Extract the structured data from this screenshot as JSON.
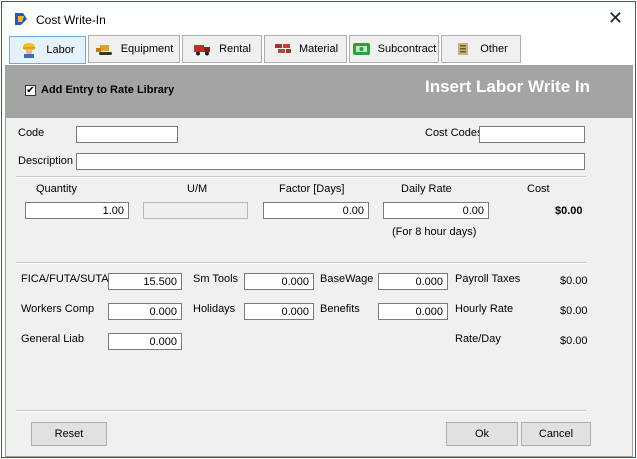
{
  "window": {
    "title": "Cost Write-In",
    "close_glyph": "✕"
  },
  "tabs": [
    {
      "label": "Labor",
      "icon": "worker-icon"
    },
    {
      "label": "Equipment",
      "icon": "bulldozer-icon"
    },
    {
      "label": "Rental",
      "icon": "rental-truck-icon"
    },
    {
      "label": "Material",
      "icon": "bricks-icon"
    },
    {
      "label": "Subcontract",
      "icon": "subcontract-icon"
    },
    {
      "label": "Other",
      "icon": "other-icon"
    }
  ],
  "banner": {
    "checkbox_label": "Add Entry to Rate Library",
    "checkbox_checked": "✔",
    "title": "Insert Labor Write In"
  },
  "form": {
    "code_label": "Code",
    "code_value": "",
    "cost_codes_label": "Cost Codes",
    "cost_codes_value": "",
    "description_label": "Description",
    "description_value": "",
    "quantity_label": "Quantity",
    "quantity_value": "1.00",
    "um_label": "U/M",
    "um_value": "",
    "factor_label": "Factor [Days]",
    "factor_value": "0.00",
    "daily_rate_label": "Daily Rate",
    "daily_rate_value": "0.00",
    "daily_rate_note": "(For 8 hour days)",
    "cost_label": "Cost",
    "cost_value": "$0.00"
  },
  "rates": {
    "fica_label": "FICA/FUTA/SUTA",
    "fica_value": "15.500",
    "workers_comp_label": "Workers Comp",
    "workers_comp_value": "0.000",
    "general_liab_label": "General Liab",
    "general_liab_value": "0.000",
    "sm_tools_label": "Sm Tools",
    "sm_tools_value": "0.000",
    "holidays_label": "Holidays",
    "holidays_value": "0.000",
    "basewage_label": "BaseWage",
    "basewage_value": "0.000",
    "benefits_label": "Benefits",
    "benefits_value": "0.000",
    "payroll_taxes_label": "Payroll Taxes",
    "payroll_taxes_value": "$0.00",
    "hourly_rate_label": "Hourly Rate",
    "hourly_rate_value": "$0.00",
    "rate_day_label": "Rate/Day",
    "rate_day_value": "$0.00"
  },
  "buttons": {
    "reset": "Reset",
    "ok": "Ok",
    "cancel": "Cancel"
  }
}
